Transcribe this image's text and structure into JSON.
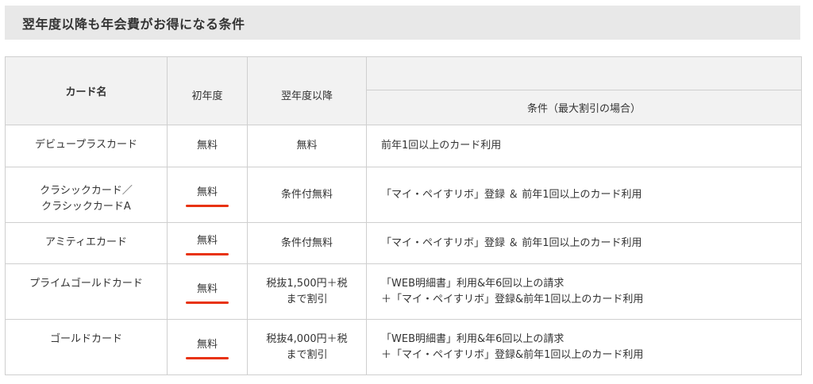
{
  "header": {
    "title": "翌年度以降も年会費がお得になる条件"
  },
  "table": {
    "headers": {
      "card_name": "カード名",
      "first_year": "初年度",
      "next_year": "翌年度以降",
      "condition": "条件（最大割引の場合）"
    },
    "rows": [
      {
        "name_lines": [
          "デビュープラスカード"
        ],
        "first_year": "無料",
        "first_year_marked": false,
        "next_year_lines": [
          "無料"
        ],
        "condition_lines": [
          "前年1回以上のカード利用"
        ]
      },
      {
        "name_lines": [
          "クラシックカード／",
          "クラシックカードA"
        ],
        "first_year": "無料",
        "first_year_marked": true,
        "next_year_lines": [
          "条件付無料"
        ],
        "condition_lines": [
          "「マイ・ペイすリボ」登録 ＆ 前年1回以上のカード利用"
        ]
      },
      {
        "name_lines": [
          "アミティエカード"
        ],
        "first_year": "無料",
        "first_year_marked": true,
        "next_year_lines": [
          "条件付無料"
        ],
        "condition_lines": [
          "「マイ・ペイすリボ」登録 ＆ 前年1回以上のカード利用"
        ]
      },
      {
        "name_lines": [
          "プライムゴールドカード"
        ],
        "first_year": "無料",
        "first_year_marked": true,
        "next_year_lines": [
          "税抜1,500円＋税",
          "まで割引"
        ],
        "condition_lines": [
          "「WEB明細書」利用&年6回以上の請求",
          "＋「マイ・ペイすリボ」登録&前年1回以上のカード利用"
        ]
      },
      {
        "name_lines": [
          "ゴールドカード"
        ],
        "first_year": "無料",
        "first_year_marked": true,
        "next_year_lines": [
          "税抜4,000円＋税",
          "まで割引"
        ],
        "condition_lines": [
          "「WEB明細書」利用&年6回以上の請求",
          "＋「マイ・ペイすリボ」登録&前年1回以上のカード利用"
        ]
      }
    ]
  },
  "colors": {
    "header_bg": "#e8e8e8",
    "table_header_bg": "#f2f2f2",
    "border": "#cfcfcf",
    "underline_marker": "#e8320f",
    "text": "#333333"
  }
}
